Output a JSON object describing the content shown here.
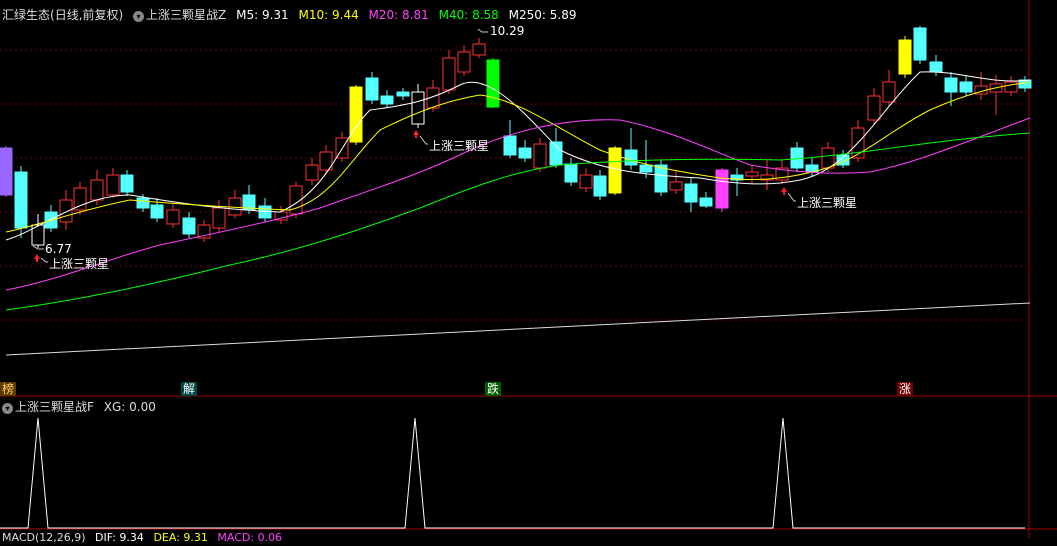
{
  "main_panel": {
    "stock_name": "汇绿生态",
    "period_label": "(日线,前复权)",
    "indicator_name": "上涨三颗星战Z",
    "ma": [
      {
        "label": "M5:",
        "value": "9.31",
        "color": "#ffffff"
      },
      {
        "label": "M10:",
        "value": "9.44",
        "color": "#ffff00"
      },
      {
        "label": "M20:",
        "value": "8.81",
        "color": "#ff40ff"
      },
      {
        "label": "M40:",
        "value": "8.58",
        "color": "#00ff00"
      },
      {
        "label": "M250:",
        "value": "5.89",
        "color": "#ffffff"
      }
    ],
    "price_high_label": "10.29",
    "price_low_label": "6.77",
    "signal_label": "上涨三颗星"
  },
  "markers": [
    {
      "text": "榜",
      "color": "#ffcc66",
      "bg": "#604000"
    },
    {
      "text": "解",
      "color": "#ffffff",
      "bg": "#004848"
    },
    {
      "text": "跌",
      "color": "#ffffff",
      "bg": "#006000"
    },
    {
      "text": "涨",
      "color": "#ffffff",
      "bg": "#700000"
    }
  ],
  "sub_panel": {
    "indicator_name": "上涨三颗星战F",
    "xg_label": "XG:",
    "xg_value": "0.00"
  },
  "bottom_panel": {
    "name": "MACD(12,26,9)",
    "dif": "DIF: 9.34",
    "dea": "DEA: 9.31",
    "macd": "MACD: 0.06"
  },
  "colors": {
    "up": "#ff3232",
    "down": "#54ffff",
    "grid": "#800000",
    "ma5": "#ffffff",
    "ma10": "#ffff00",
    "ma20": "#ff40ff",
    "ma40": "#00ff00"
  },
  "icons": {
    "dropdown": "circle-chevron-down-icon",
    "signal": "red-arrow-icon"
  }
}
